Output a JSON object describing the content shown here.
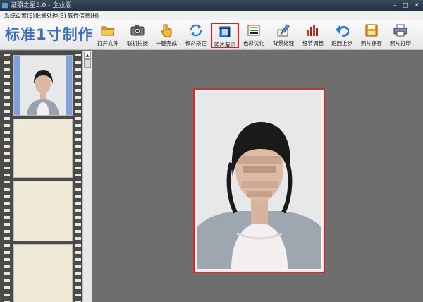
{
  "window": {
    "title": "证照之星5.0 - 企业版",
    "controls": [
      "–",
      "□",
      "✕"
    ]
  },
  "menu": [
    {
      "label": "系统设置(S)"
    },
    {
      "label": "批量处理(B)"
    },
    {
      "label": "软件信息(H)"
    }
  ],
  "mode_title": "标准1寸制作",
  "toolbar": {
    "tools": [
      {
        "label": "打开文件",
        "icon": "folder-open-icon"
      },
      {
        "label": "联机拍摄",
        "icon": "camera-icon"
      },
      {
        "label": "一键完成",
        "icon": "hand-pointer-icon"
      },
      {
        "label": "倾斜矫正",
        "icon": "rotate-arrows-icon"
      },
      {
        "label": "照片裁切",
        "icon": "crop-icon"
      },
      {
        "label": "色彩优化",
        "icon": "color-palette-icon"
      },
      {
        "label": "背景处理",
        "icon": "paint-brush-icon"
      },
      {
        "label": "细节调整",
        "icon": "bar-adjust-icon"
      },
      {
        "label": "返回上步",
        "icon": "undo-arrow-icon"
      },
      {
        "label": "照片保存",
        "icon": "floppy-save-icon"
      },
      {
        "label": "照片打印",
        "icon": "printer-icon"
      }
    ],
    "active_tool": "照片裁切"
  },
  "colors": {
    "title_blue": "#3f6fb0",
    "highlight_red": "#e02626",
    "canvas_gray": "#6e6e6e",
    "frame_selected": "#7ea3d8",
    "frame_empty": "#efead6"
  }
}
